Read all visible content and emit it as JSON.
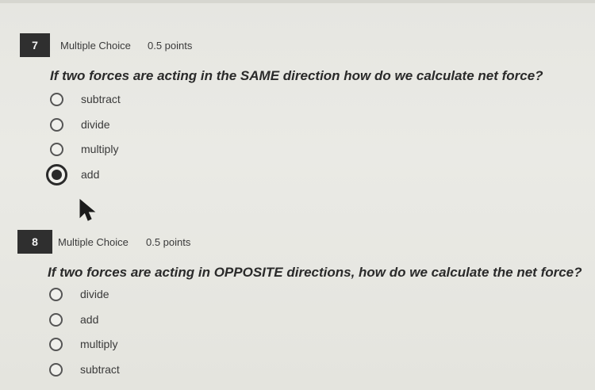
{
  "questions": [
    {
      "number": "7",
      "type": "Multiple Choice",
      "points": "0.5 points",
      "prompt": "If two forces are acting in the SAME direction how do we calculate net force?",
      "options": [
        {
          "label": "subtract",
          "selected": false
        },
        {
          "label": "divide",
          "selected": false
        },
        {
          "label": "multiply",
          "selected": false
        },
        {
          "label": "add",
          "selected": true
        }
      ]
    },
    {
      "number": "8",
      "type": "Multiple Choice",
      "points": "0.5 points",
      "prompt": "If two forces are acting in OPPOSITE directions, how do we calculate the net force?",
      "options": [
        {
          "label": "divide",
          "selected": false
        },
        {
          "label": "add",
          "selected": false
        },
        {
          "label": "multiply",
          "selected": false
        },
        {
          "label": "subtract",
          "selected": false
        }
      ]
    }
  ],
  "colors": {
    "number_badge_bg": "#2f2f2f",
    "page_bg": "#e8e8e3"
  }
}
